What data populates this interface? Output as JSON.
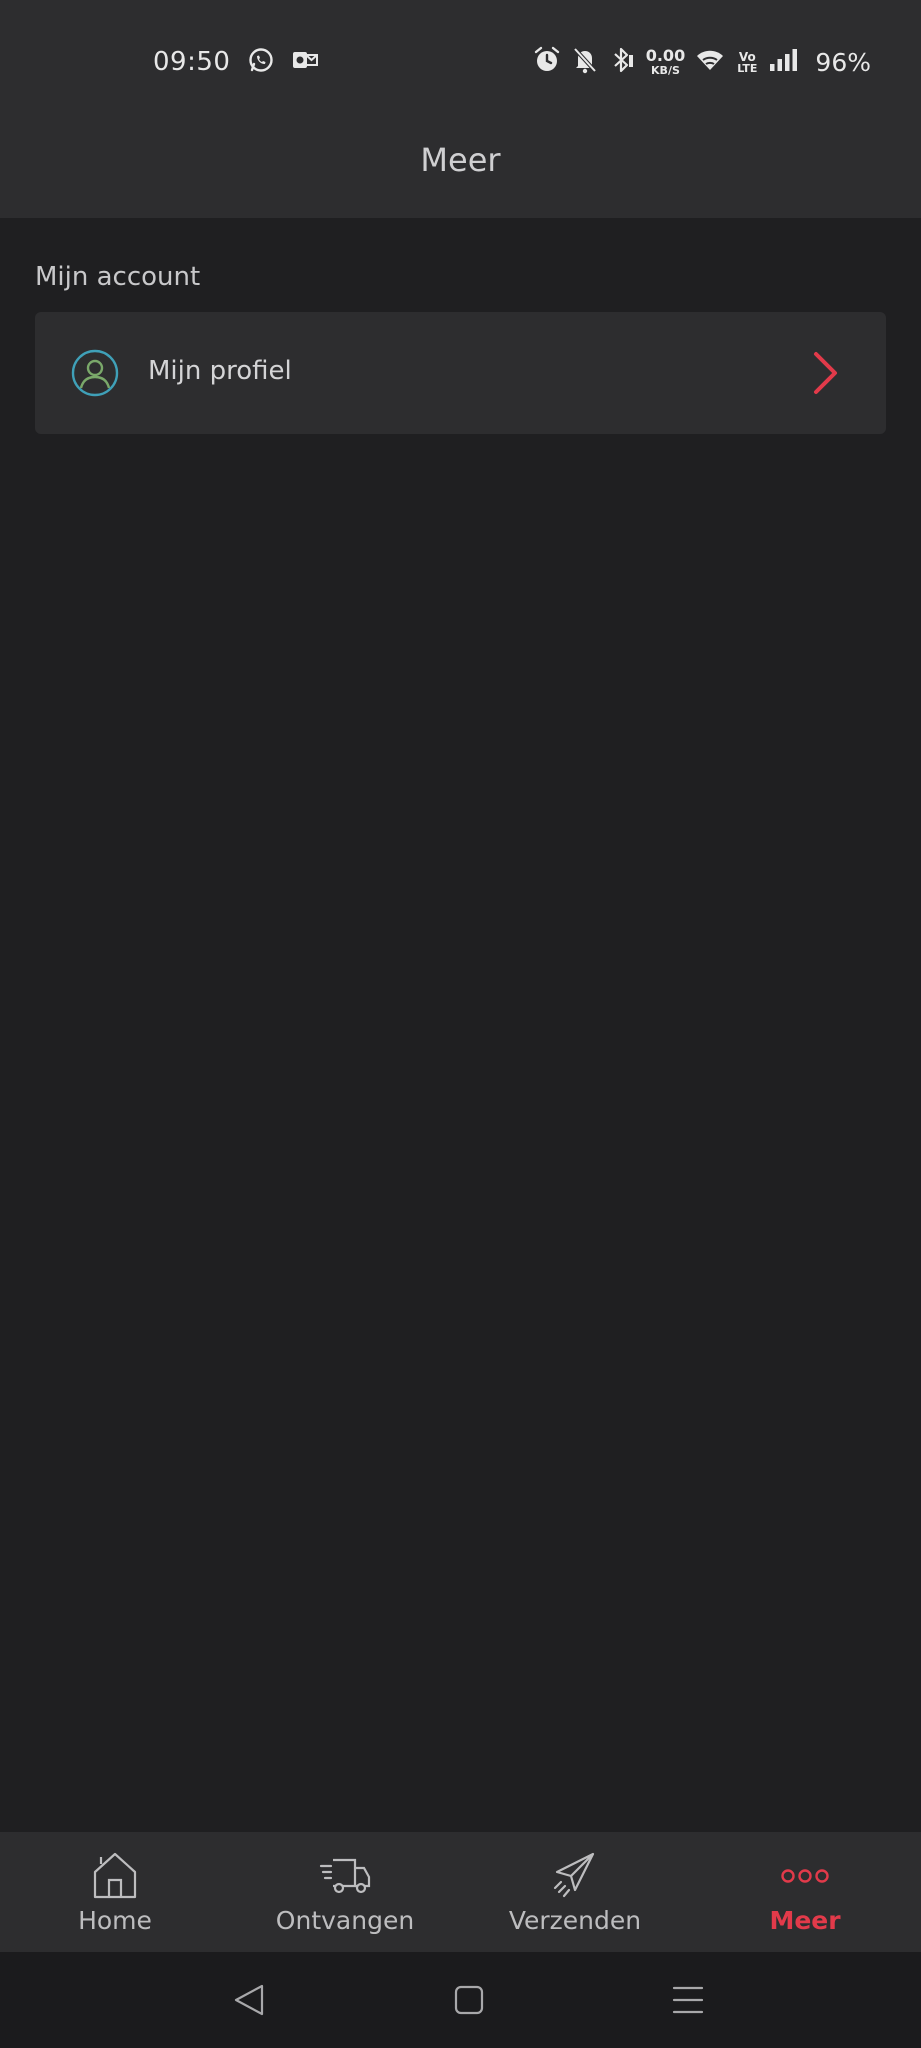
{
  "status_bar": {
    "time": "09:50",
    "net_speed_value": "0.00",
    "net_speed_unit": "KB/S",
    "volte_top": "Vo",
    "volte_bottom": "LTE",
    "battery": "96%",
    "icons": [
      "whatsapp-icon",
      "outlook-icon",
      "alarm-icon",
      "bell-off-icon",
      "bluetooth-icon",
      "wifi-icon",
      "signal-icon"
    ]
  },
  "header": {
    "title": "Meer"
  },
  "account_section": {
    "label": "Mijn account",
    "items": [
      {
        "label": "Mijn profiel",
        "icon": "profile-icon"
      }
    ]
  },
  "bottom_nav": {
    "items": [
      {
        "label": "Home",
        "icon": "home-icon",
        "active": false
      },
      {
        "label": "Ontvangen",
        "icon": "delivery-truck-icon",
        "active": false
      },
      {
        "label": "Verzenden",
        "icon": "paper-plane-icon",
        "active": false
      },
      {
        "label": "Meer",
        "icon": "more-dots-icon",
        "active": true
      }
    ]
  },
  "colors": {
    "accent": "#e23a4a",
    "surface": "#2d2d2f",
    "background": "#1f1f21",
    "profile_icon_outer": "#3fa0b8",
    "profile_icon_inner": "#7aa86a"
  }
}
